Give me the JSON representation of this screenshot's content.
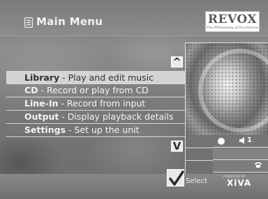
{
  "header": {
    "title": "Main Menu",
    "menu_icon": "list-icon"
  },
  "logo": {
    "brand": "REVOX",
    "tagline": "The Philosophy of Excellence"
  },
  "menu": {
    "items": [
      {
        "keyword": "Library",
        "description": " - Play and edit music",
        "selected": true
      },
      {
        "keyword": "CD",
        "description": " - Record or play from CD",
        "selected": false
      },
      {
        "keyword": "Line-In",
        "description": " - Record from input",
        "selected": false
      },
      {
        "keyword": "Output",
        "description": " - Display playback details",
        "selected": false
      },
      {
        "keyword": "Settings",
        "description": " - Set up the unit",
        "selected": false
      }
    ]
  },
  "scroll": {
    "up_icon": "scroll-up-icon",
    "down_icon": "scroll-down-icon",
    "up_glyph": "^",
    "down_glyph": "V",
    "cursor_glyph": ">"
  },
  "status": {
    "output_number": "1",
    "record_icon": "record-dot-icon",
    "speaker_icon": "speaker-icon",
    "phone_icon": "phone-icon"
  },
  "footer": {
    "select_label": "Select",
    "select_icon": "checkmark-icon",
    "powered_by": "POWERED BY",
    "partner_logo": "XiVA"
  },
  "colors": {
    "selected_bg": "#d4d4d4",
    "selected_text": "#303030",
    "menu_text": "#f4f4f4",
    "panel_gray": "#7c7c7c"
  }
}
